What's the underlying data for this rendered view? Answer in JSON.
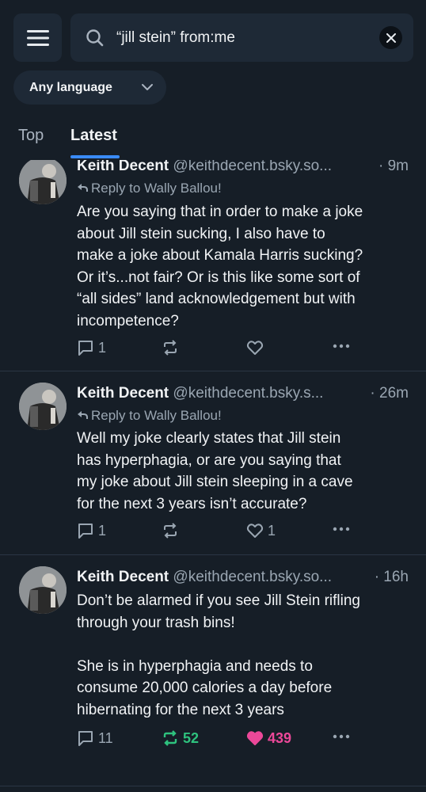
{
  "search": {
    "query": "“jill stein” from:me"
  },
  "filters": {
    "language": "Any language"
  },
  "tabs": [
    {
      "label": "Top"
    },
    {
      "label": "Latest"
    }
  ],
  "posts": [
    {
      "name": "Keith Decent",
      "handle": "@keithdecent.bsky.so...",
      "time": "· 9m",
      "reply_to": "Reply to Wally Ballou!",
      "text": "Are you saying that in order to make a joke\nabout Jill stein sucking, I also have to\nmake a joke about Kamala Harris sucking?\nOr it’s...not fair? Or is this like some sort of\n“all sides” land acknowledgement but with\nincompetence?",
      "replies": "1",
      "reposts": "",
      "likes": ""
    },
    {
      "name": "Keith Decent",
      "handle": "@keithdecent.bsky.s...",
      "time": "· 26m",
      "reply_to": "Reply to Wally Ballou!",
      "text": "Well my joke clearly states that Jill stein\nhas hyperphagia, or are you saying that\nmy joke about Jill stein sleeping in a cave\nfor the next 3 years isn’t accurate?",
      "replies": "1",
      "reposts": "",
      "likes": "1"
    },
    {
      "name": "Keith Decent",
      "handle": "@keithdecent.bsky.so...",
      "time": "· 16h",
      "reply_to": "",
      "text": "Don’t be alarmed if you see Jill Stein rifling\nthrough your trash bins!\n\nShe is in hyperphagia and needs to\nconsume 20,000 calories a day before\nhibernating for the next 3 years",
      "replies": "11",
      "reposts": "52",
      "likes": "439"
    }
  ],
  "colors": {
    "background": "#161e27",
    "accent": "#3a8bf7",
    "repost_active": "#2ec27e",
    "like_active": "#ec4899"
  }
}
